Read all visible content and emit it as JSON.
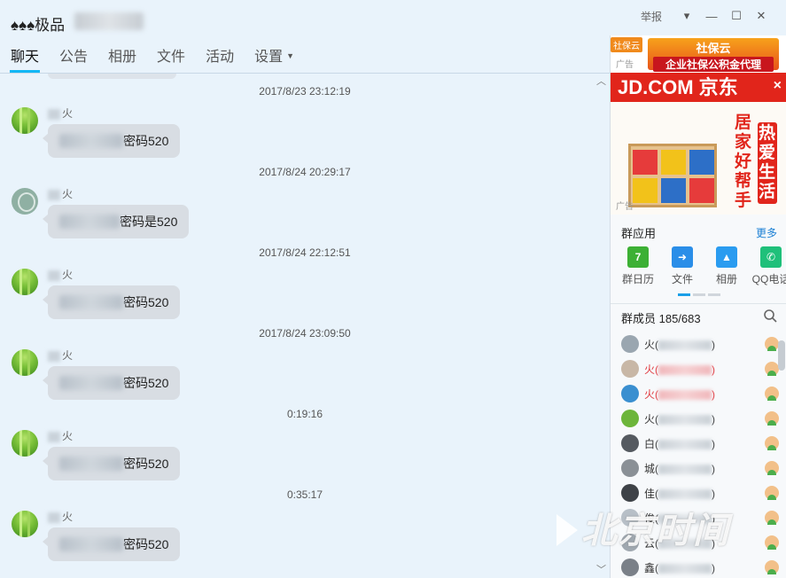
{
  "window": {
    "title": "♠♠♠极品",
    "report_label": "举报",
    "controls": [
      "minimize",
      "maximize",
      "close"
    ]
  },
  "tabs": [
    {
      "label": "聊天",
      "active": true
    },
    {
      "label": "公告",
      "active": false
    },
    {
      "label": "相册",
      "active": false
    },
    {
      "label": "文件",
      "active": false
    },
    {
      "label": "活动",
      "active": false
    },
    {
      "label": "设置",
      "active": false,
      "dropdown": true
    }
  ],
  "chat": {
    "messages": [
      {
        "timestamp": "2017/8/23 23:12:19",
        "nick": "火",
        "avatar": "bamboo",
        "text": "密码520"
      },
      {
        "timestamp": "2017/8/24 20:29:17",
        "nick": "火",
        "avatar": "gray-face",
        "text": "密码是520"
      },
      {
        "timestamp": "2017/8/24 22:12:51",
        "nick": "火",
        "avatar": "bamboo",
        "text": "密码520"
      },
      {
        "timestamp": "2017/8/24 23:09:50",
        "nick": "火",
        "avatar": "bamboo",
        "text": "密码520"
      },
      {
        "timestamp": "0:19:16",
        "nick": "火",
        "avatar": "bamboo",
        "text": "密码520"
      },
      {
        "timestamp": "0:35:17",
        "nick": "火",
        "avatar": "bamboo",
        "text": "密码520"
      }
    ]
  },
  "sidebar": {
    "ad_top": {
      "brand": "社保云",
      "line1": "社保云",
      "line2": "企业社保公积金代理",
      "label": "广告"
    },
    "ad_jd": {
      "logo": "JD.COM 京东",
      "slogan_col1": "居家好帮手",
      "slogan_col2": "热爱生活",
      "label": "广告",
      "close": "×"
    },
    "apps": {
      "title": "群应用",
      "more": "更多",
      "items": [
        {
          "label": "群日历",
          "icon": "calendar-icon",
          "color": "#3cb034"
        },
        {
          "label": "文件",
          "icon": "folder-icon",
          "color": "#2a8ee8"
        },
        {
          "label": "相册",
          "icon": "photo-icon",
          "color": "#2a9cf0"
        },
        {
          "label": "QQ电话",
          "icon": "phone-icon",
          "color": "#1fc07a"
        }
      ]
    },
    "members": {
      "title": "群成员 185/683",
      "list": [
        {
          "name": "火",
          "red": false,
          "avatar_color": "#9aa6b0"
        },
        {
          "name": "火",
          "red": true,
          "avatar_color": "#c8b7a6"
        },
        {
          "name": "火",
          "red": true,
          "avatar_color": "#3a8fd0"
        },
        {
          "name": "火",
          "red": false,
          "avatar_color": "#6cb53a"
        },
        {
          "name": "白",
          "red": false,
          "avatar_color": "#555a60"
        },
        {
          "name": "城",
          "red": false,
          "avatar_color": "#8a9096"
        },
        {
          "name": "佳",
          "red": false,
          "avatar_color": "#3e4247"
        },
        {
          "name": "俊",
          "red": false,
          "avatar_color": "#b7bfc7"
        },
        {
          "name": "云",
          "red": false,
          "avatar_color": "#a0a8b0"
        },
        {
          "name": "鑫",
          "red": false,
          "avatar_color": "#7a8088"
        }
      ]
    }
  },
  "watermark": "北京时间"
}
